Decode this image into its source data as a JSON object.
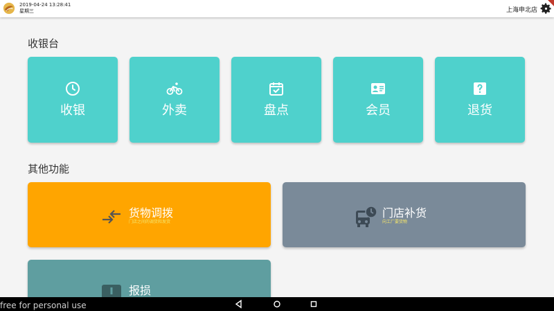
{
  "header": {
    "date": "2019-04-24 13:28:41",
    "weekday": "星期三",
    "store_name": "上海申北店"
  },
  "cashier": {
    "title": "收银台",
    "tiles": [
      {
        "label": "收银",
        "icon": "clock-icon"
      },
      {
        "label": "外卖",
        "icon": "bicycle-icon"
      },
      {
        "label": "盘点",
        "icon": "calendar-check-icon"
      },
      {
        "label": "会员",
        "icon": "contact-card-icon"
      },
      {
        "label": "退货",
        "icon": "question-icon"
      }
    ]
  },
  "other": {
    "title": "其他功能",
    "cards": [
      {
        "title": "货物调拨",
        "subtitle": "门店之间的调货和发货",
        "icon": "transfer-arrows-icon",
        "color": "#ffa500"
      },
      {
        "title": "门店补货",
        "subtitle": "向工厂要货物",
        "icon": "bus-clock-icon",
        "color": "#7a8a99"
      },
      {
        "title": "报损",
        "subtitle": "",
        "icon": "alert-icon",
        "color": "#5f9ea0"
      }
    ]
  },
  "colors": {
    "tile": "#4fd1cc",
    "topbar": "#ffffff",
    "background": "#f4f4f4"
  },
  "watermark": "free for personal use"
}
